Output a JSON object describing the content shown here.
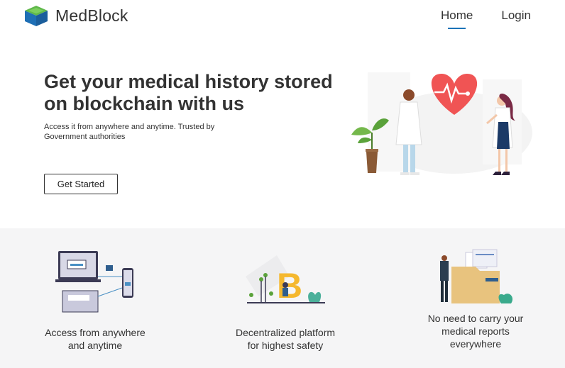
{
  "brand": {
    "name": "MedBlock"
  },
  "nav": {
    "home": "Home",
    "login": "Login"
  },
  "hero": {
    "title_line1": "Get your medical history stored",
    "title_line2": "on blockchain with us",
    "subtitle_line1": "Access it from anywhere and anytime. Trusted by",
    "subtitle_line2": "Government authorities",
    "cta_label": "Get Started"
  },
  "features": [
    {
      "line1": "Access from anywhere",
      "line2": "and anytime"
    },
    {
      "line1": "Decentralized platform",
      "line2": "for highest safety"
    },
    {
      "line1": "No need to carry your",
      "line2": "medical reports",
      "line3": "everywhere"
    }
  ],
  "crypto_symbol": "B",
  "colors": {
    "accent": "#1a73b8",
    "heart": "#f05454",
    "bitcoin": "#f5b82e",
    "features_bg": "#f5f5f6"
  }
}
